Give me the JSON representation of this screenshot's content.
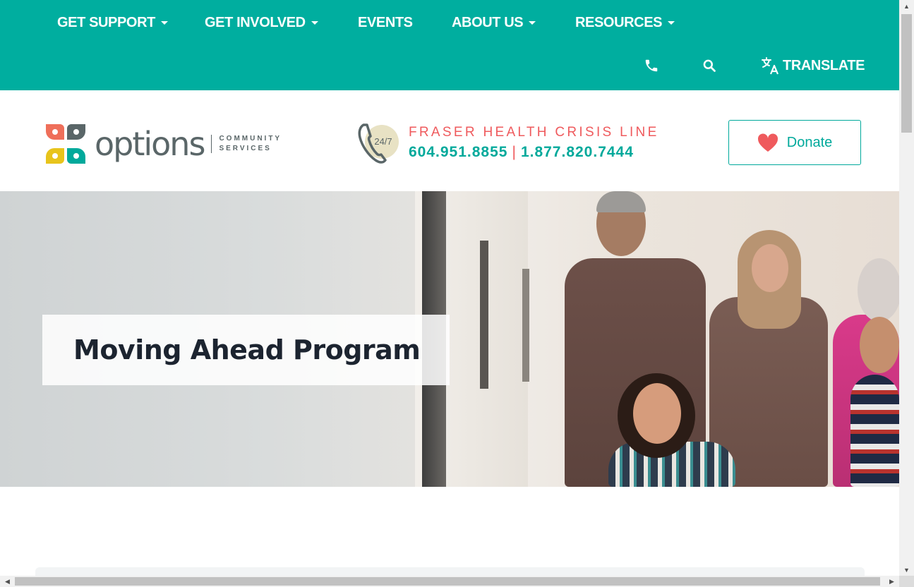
{
  "nav": {
    "items": [
      {
        "label": "GET SUPPORT",
        "has_dropdown": true
      },
      {
        "label": "GET INVOLVED",
        "has_dropdown": true
      },
      {
        "label": "EVENTS",
        "has_dropdown": false
      },
      {
        "label": "ABOUT US",
        "has_dropdown": true
      },
      {
        "label": "RESOURCES",
        "has_dropdown": true
      }
    ]
  },
  "utility": {
    "phone_icon": "phone-icon",
    "search_icon": "search-icon",
    "translate_icon": "translate-icon",
    "translate_label": "TRANSLATE"
  },
  "logo": {
    "word": "options",
    "sub_line1": "COMMUNITY",
    "sub_line2": "SERVICES"
  },
  "crisis": {
    "badge": "24/7",
    "title": "FRASER HEALTH CRISIS LINE",
    "phone1": "604.951.8855",
    "separator": "|",
    "phone2": "1.877.820.7444"
  },
  "donate": {
    "label": "Donate",
    "icon": "heart-icon"
  },
  "hero": {
    "title": "Moving Ahead Program"
  },
  "colors": {
    "brand_teal": "#00ae9f",
    "accent_coral": "#ef5a5d",
    "text_dark": "#1c2430"
  }
}
